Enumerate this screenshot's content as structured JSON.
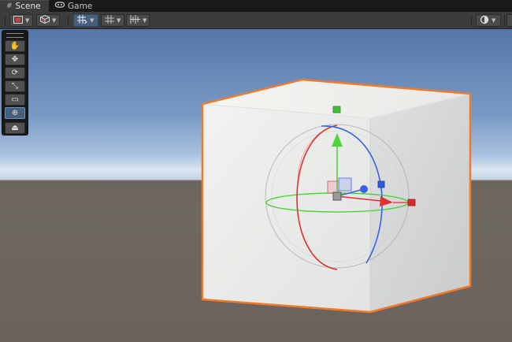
{
  "tabs": [
    {
      "label": "Scene",
      "icon": "hash-icon",
      "active": true
    },
    {
      "label": "Game",
      "icon": "gamepad-icon",
      "active": false
    }
  ],
  "toolbar": {
    "draw_mode_icon": "shaded-mode-icon",
    "render_mode_icon": "cube-icon",
    "grid_snap_icon": "grid-snap-icon",
    "grid_visibility_icon": "grid-icon",
    "increment_snap_icon": "increment-snap-icon",
    "gizmos_icon": "circle-icon"
  },
  "tools": [
    {
      "name": "view-tool",
      "glyph": "✋",
      "active": false
    },
    {
      "name": "move-tool",
      "glyph": "✥",
      "active": false
    },
    {
      "name": "rotate-tool",
      "glyph": "⟳",
      "active": false
    },
    {
      "name": "scale-tool",
      "glyph": "⤡",
      "active": false
    },
    {
      "name": "rect-tool",
      "glyph": "▭",
      "active": false
    },
    {
      "name": "transform-tool",
      "glyph": "⊕",
      "active": true
    },
    {
      "name": "custom-tool",
      "glyph": "⏏",
      "active": false
    }
  ],
  "colors": {
    "selection_outline": "#f07a2a",
    "axis_x": "#e03030",
    "axis_y": "#4fd23a",
    "axis_z": "#3a62e6",
    "active_tool": "#46607c"
  }
}
